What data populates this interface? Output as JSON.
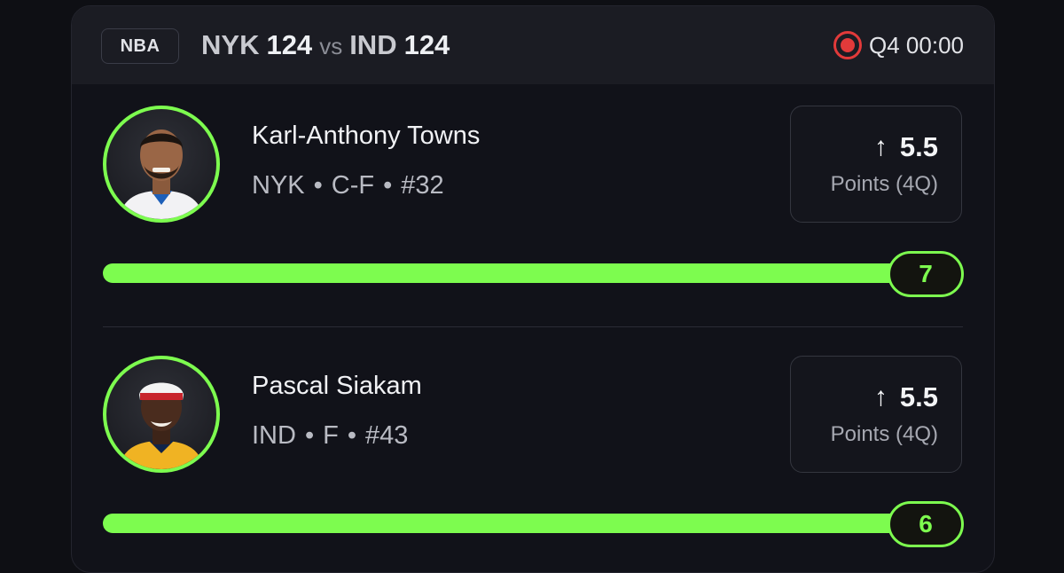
{
  "header": {
    "league": "NBA",
    "home_team": "NYK",
    "home_score": "124",
    "vs": "vs",
    "away_team": "IND",
    "away_score": "124",
    "game_clock": "Q4 00:00",
    "live_color": "#e23a3a"
  },
  "accent_color": "#7dfc4f",
  "players": [
    {
      "name": "Karl-Anthony Towns",
      "team": "NYK",
      "position": "C-F",
      "number": "#32",
      "prop_direction_icon": "arrow-up-icon",
      "prop_line": "5.5",
      "prop_label": "Points (4Q)",
      "current_value": "7",
      "progress_fraction": 1.0
    },
    {
      "name": "Pascal Siakam",
      "team": "IND",
      "position": "F",
      "number": "#43",
      "prop_direction_icon": "arrow-up-icon",
      "prop_line": "5.5",
      "prop_label": "Points (4Q)",
      "current_value": "6",
      "progress_fraction": 1.0
    }
  ]
}
